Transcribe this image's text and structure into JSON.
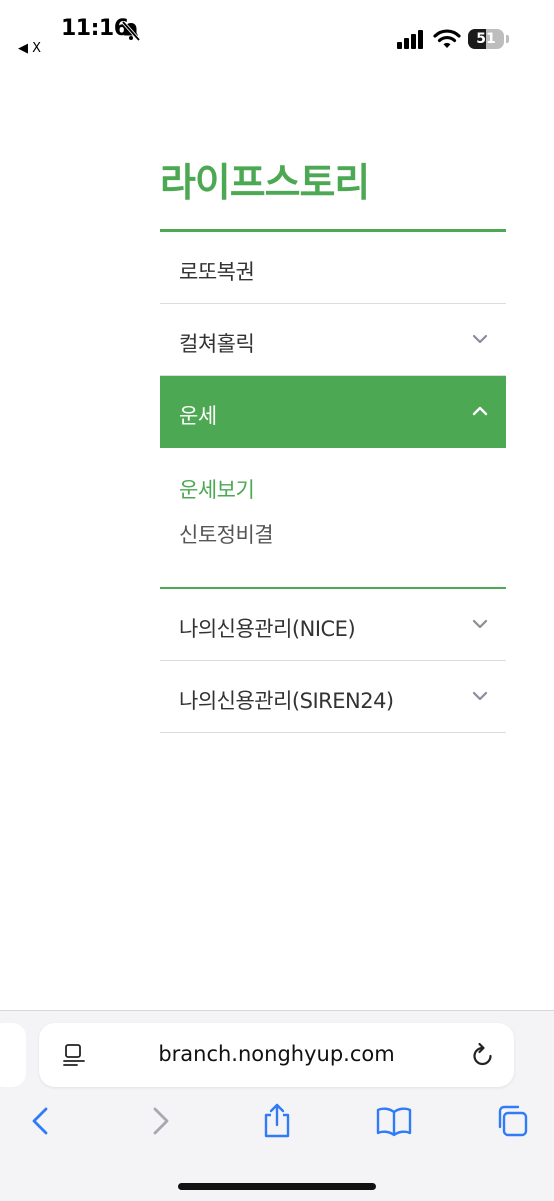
{
  "status_bar": {
    "time": "11:16",
    "back_app_label": "◀ X",
    "battery_level": "51"
  },
  "menu": {
    "title": "라이프스토리",
    "items": [
      {
        "label": "로또복권",
        "has_chevron": false
      },
      {
        "label": "컬쳐홀릭",
        "chevron": "chevron-down"
      },
      {
        "label": "운세",
        "chevron": "chevron-up",
        "expanded": true,
        "sub_items": [
          {
            "label": "운세보기",
            "current": true
          },
          {
            "label": "신토정비결",
            "current": false
          }
        ]
      },
      {
        "label": "나의신용관리(NICE)",
        "chevron": "chevron-down"
      },
      {
        "label": "나의신용관리(SIREN24)",
        "chevron": "chevron-down"
      }
    ]
  },
  "browser": {
    "url": "branch.nonghyup.com",
    "toolbar": [
      "back-icon",
      "forward-icon",
      "share-icon",
      "bookmarks-icon",
      "tabs-icon"
    ]
  },
  "colors": {
    "accent": "#4ca852",
    "link_blue": "#2f7cf6",
    "divider": "#dcdce0"
  }
}
